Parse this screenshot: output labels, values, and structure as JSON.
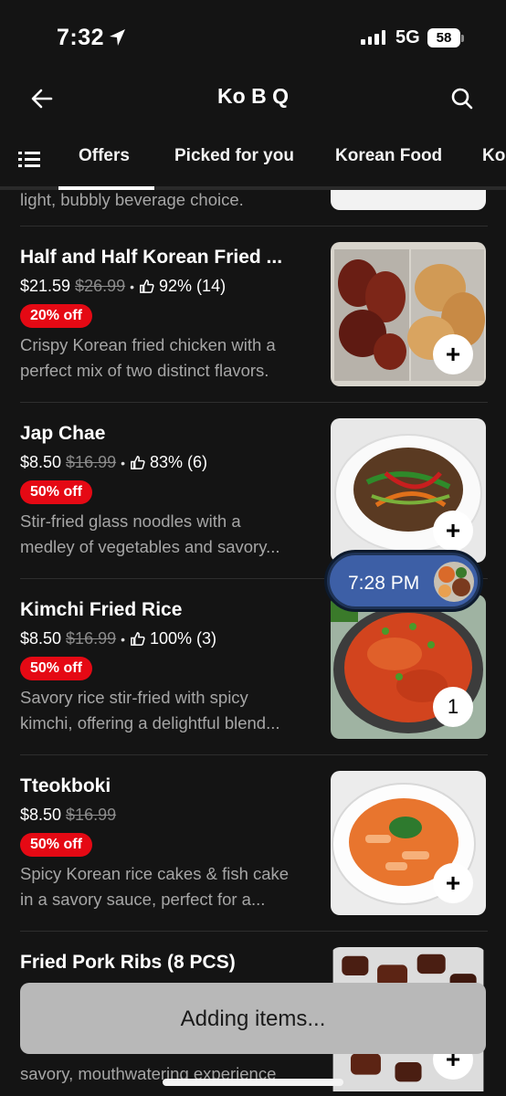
{
  "status_bar": {
    "time": "7:32",
    "network": "5G",
    "battery": "58"
  },
  "header": {
    "title": "Ko B Q"
  },
  "tabs": [
    {
      "label": "Offers"
    },
    {
      "label": "Picked for you"
    },
    {
      "label": "Korean Food"
    },
    {
      "label": "Ko"
    }
  ],
  "partial_item": {
    "desc": "light, bubbly beverage choice."
  },
  "items": [
    {
      "name": "Half and Half Korean Fried ...",
      "price": "$21.59",
      "old_price": "$26.99",
      "rating": "92% (14)",
      "badge": "20% off",
      "desc1": "Crispy Korean fried chicken with a",
      "desc2": "perfect mix of two distinct flavors.",
      "button": "+"
    },
    {
      "name": "Jap Chae",
      "price": "$8.50",
      "old_price": "$16.99",
      "rating": "83% (6)",
      "badge": "50% off",
      "desc1": "Stir-fried glass noodles with a",
      "desc2": "medley of vegetables and savory...",
      "button": "+"
    },
    {
      "name": "Kimchi Fried Rice",
      "price": "$8.50",
      "old_price": "$16.99",
      "rating": "100% (3)",
      "badge": "50% off",
      "desc1": "Savory rice stir-fried with spicy",
      "desc2": "kimchi, offering a delightful blend...",
      "button": "1"
    },
    {
      "name": "Tteokboki",
      "price": "$8.50",
      "old_price": "$16.99",
      "badge": "50% off",
      "desc1": "Spicy Korean rice cakes & fish cake",
      "desc2": "in a savory sauce, perfect for a...",
      "button": "+"
    },
    {
      "name": "Fried Pork Ribs (8 PCS)",
      "desc2": "savory, mouthwatering experience",
      "button": "+"
    }
  ],
  "timer_pill": {
    "time": "7:28 PM"
  },
  "adding_banner": {
    "label": "Adding items..."
  },
  "colors": {
    "background": "#141414",
    "badge_red": "#e50914",
    "pill_blue": "#3d5fa6"
  }
}
